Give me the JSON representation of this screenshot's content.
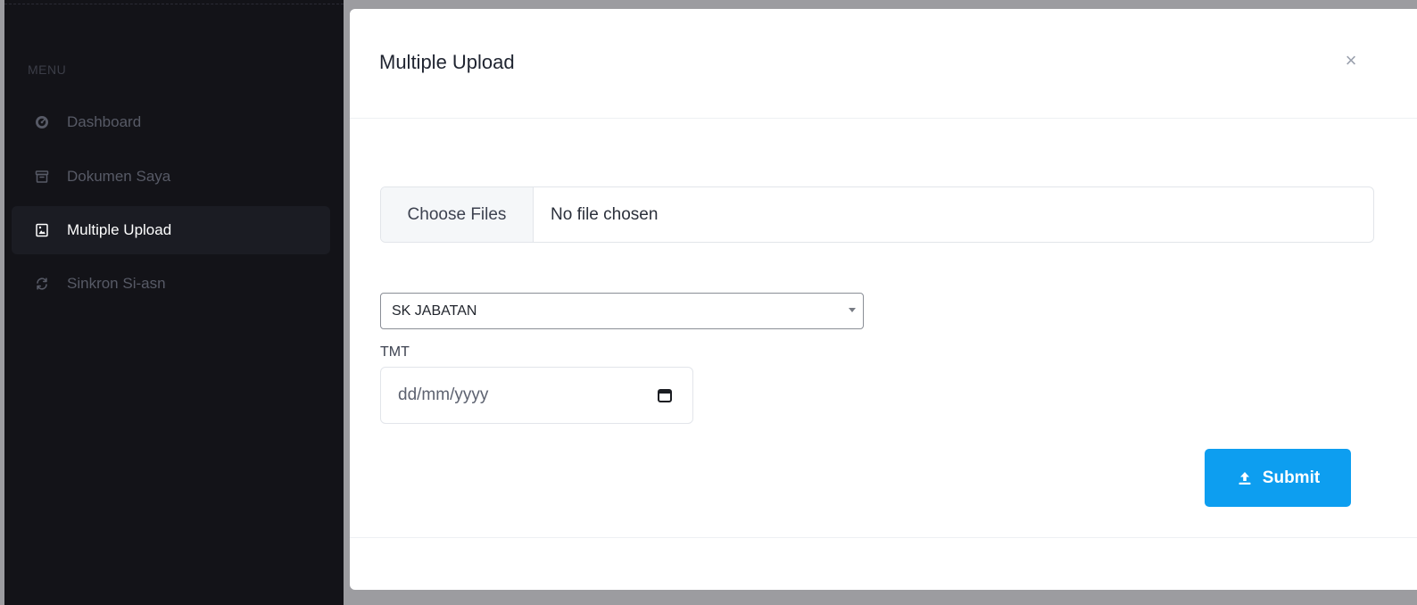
{
  "sidebar": {
    "menu_heading": "MENU",
    "items": [
      {
        "label": "Dashboard",
        "icon": "dashboard-gauge-icon",
        "active": false
      },
      {
        "label": "Dokumen Saya",
        "icon": "archive-box-icon",
        "active": false
      },
      {
        "label": "Multiple Upload",
        "icon": "image-document-icon",
        "active": true
      },
      {
        "label": "Sinkron Si-asn",
        "icon": "sync-icon",
        "active": false
      }
    ]
  },
  "modal": {
    "title": "Multiple Upload",
    "close_symbol": "×",
    "file_input": {
      "button_label": "Choose Files",
      "status": "No file chosen"
    },
    "document_type": {
      "selected": "SK JABATAN"
    },
    "tmt": {
      "label": "TMT",
      "placeholder": "dd/mm/yyyy"
    },
    "submit": {
      "label": "Submit",
      "icon": "upload-icon"
    }
  },
  "colors": {
    "sidebar_bg": "#131318",
    "active_item_bg": "#1b1c23",
    "submit_bg": "#0d9ef0",
    "backdrop": "#9c9ca0"
  }
}
